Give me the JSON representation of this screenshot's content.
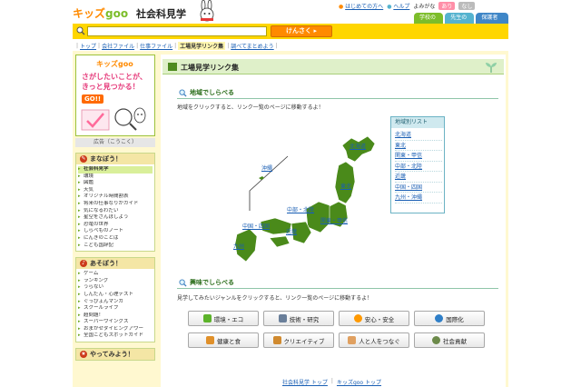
{
  "header": {
    "logo_kids": "キッズ",
    "logo_goo": "goo",
    "site_title": "社会科見学",
    "links": {
      "first_time": "はじめての方へ",
      "help": "ヘルプ",
      "yomigana": "よみがな",
      "on": "あり",
      "off": "なし"
    },
    "tabs": [
      {
        "label": "学校のページ",
        "color": "#7cbd2a"
      },
      {
        "label": "先生のページ",
        "color": "#55b3cf"
      },
      {
        "label": "保護者のページ",
        "color": "#3f86c7"
      }
    ]
  },
  "search": {
    "value": "",
    "button_label": "けんさく"
  },
  "breadcrumb": [
    "トップ",
    "会社ファイル",
    "仕事ファイル",
    "工場見学リンク集",
    "調べてまとめよう"
  ],
  "sidebar": {
    "ad": {
      "logo": "キッズgoo",
      "line1": "さがしたいことが、",
      "line2": "きっと見つかる！",
      "go": "GO!!",
      "caption": "広告（こうこく）"
    },
    "manabou": {
      "title": "まなぼう！",
      "items": [
        "社会科見学",
        "環境",
        "図鑑",
        "天気",
        "オリジナル時間割表",
        "将来の仕事なりかガイド",
        "気になるわだい",
        "星空をさんぽしよう",
        "恐竜の世界",
        "しらべものノート",
        "にんきのことば",
        "こども国辞記"
      ]
    },
    "asobou": {
      "title": "あそぼう！",
      "items": [
        "ゲーム",
        "ランキング",
        "うらない",
        "しんだん・心理テスト",
        "ぐっぴょんマンガ",
        "スクールライブ",
        "超問題！",
        "スーパーウイングス",
        "おまかせダイビングアワー",
        "全国こどもスポットガイド"
      ]
    },
    "yattemiyou": {
      "title": "やってみよう！"
    }
  },
  "main": {
    "title": "工場見学リンク集",
    "area": {
      "heading": "地域でしらべる",
      "description": "地域をクリックすると、リンク一覧のページに移動するよ！",
      "map_labels": [
        "北海道",
        "沖縄",
        "東北",
        "中部・北陸",
        "関東・甲信",
        "中国・四国",
        "近畿",
        "九州"
      ]
    },
    "region_list": {
      "title": "地域別リスト",
      "items": [
        "北海道",
        "東北",
        "関東・甲信",
        "中部・北陸",
        "近畿",
        "中国・四国",
        "九州・沖縄"
      ]
    },
    "interest": {
      "heading": "興味でしらべる",
      "description": "見学してみたいジャンルをクリックすると、リンク一覧のページに移動するよ！",
      "genres": [
        {
          "label": "環境・エコ",
          "icon": "leaf-icon",
          "color": "#5cb32a"
        },
        {
          "label": "技術・研究",
          "icon": "computer-icon",
          "color": "#6a7f9a"
        },
        {
          "label": "安心・安全",
          "icon": "heart-icon",
          "color": "#ff9900"
        },
        {
          "label": "国際化",
          "icon": "globe-icon",
          "color": "#2f7fc8"
        },
        {
          "label": "健康と食",
          "icon": "food-icon",
          "color": "#e0902a"
        },
        {
          "label": "クリエイティブ",
          "icon": "palette-icon",
          "color": "#d08a2f"
        },
        {
          "label": "人と人をつなぐ",
          "icon": "handshake-icon",
          "color": "#e0a060"
        },
        {
          "label": "社会貢献",
          "icon": "group-icon",
          "color": "#6c8a4a"
        }
      ]
    }
  },
  "footer": {
    "links": [
      "社会科見学 トップ",
      "キッズgoo トップ"
    ]
  }
}
